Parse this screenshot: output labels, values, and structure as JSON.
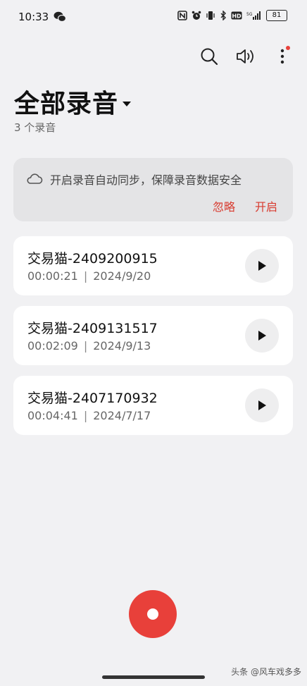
{
  "status": {
    "time": "10:33",
    "battery": "81"
  },
  "header": {
    "title": "全部录音",
    "subtitle": "3 个录音"
  },
  "sync_card": {
    "message": "开启录音自动同步，保障录音数据安全",
    "ignore_label": "忽略",
    "enable_label": "开启"
  },
  "recordings": [
    {
      "title": "交易猫-2409200915",
      "duration": "00:00:21",
      "date": "2024/9/20"
    },
    {
      "title": "交易猫-2409131517",
      "duration": "00:02:09",
      "date": "2024/9/13"
    },
    {
      "title": "交易猫-2407170932",
      "duration": "00:04:41",
      "date": "2024/7/17"
    }
  ],
  "watermark": "头条 @风车戏多多",
  "colors": {
    "accent": "#e8403a",
    "background": "#f1f1f3",
    "card": "#ffffff"
  }
}
